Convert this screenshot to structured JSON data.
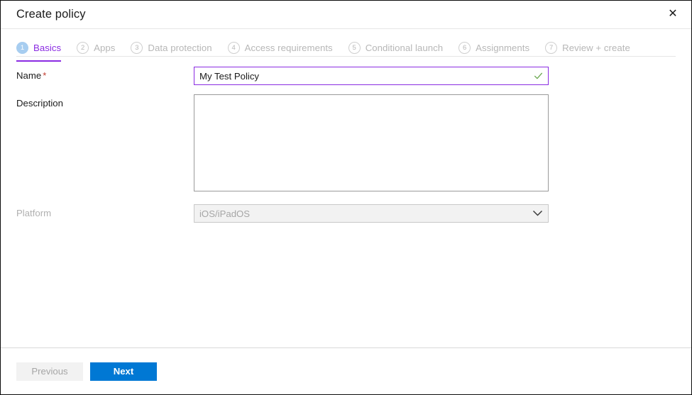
{
  "window": {
    "title": "Create policy",
    "close_icon": "close-icon",
    "close_glyph": "✕"
  },
  "wizard": {
    "tabs": [
      {
        "num": "1",
        "label": "Basics",
        "active": true
      },
      {
        "num": "2",
        "label": "Apps",
        "active": false
      },
      {
        "num": "3",
        "label": "Data protection",
        "active": false
      },
      {
        "num": "4",
        "label": "Access requirements",
        "active": false
      },
      {
        "num": "5",
        "label": "Conditional launch",
        "active": false
      },
      {
        "num": "6",
        "label": "Assignments",
        "active": false
      },
      {
        "num": "7",
        "label": "Review + create",
        "active": false
      }
    ],
    "active_color": "#8a2be2",
    "active_badge_color": "#a7cdf0",
    "inactive_color": "#b7b7b7"
  },
  "form": {
    "name": {
      "label": "Name",
      "required_marker": "*",
      "value": "My Test Policy",
      "placeholder": "",
      "valid_icon": "checkmark-icon",
      "border_color": "#8a2be2",
      "valid_color": "#6aa84f"
    },
    "description": {
      "label": "Description",
      "value": "",
      "placeholder": ""
    },
    "platform": {
      "label": "Platform",
      "value": "iOS/iPadOS",
      "disabled": true,
      "chevron_icon": "chevron-down-icon",
      "options": [
        "iOS/iPadOS"
      ]
    }
  },
  "footer": {
    "previous_label": "Previous",
    "next_label": "Next",
    "previous_disabled": true,
    "primary_color": "#0078d4"
  }
}
